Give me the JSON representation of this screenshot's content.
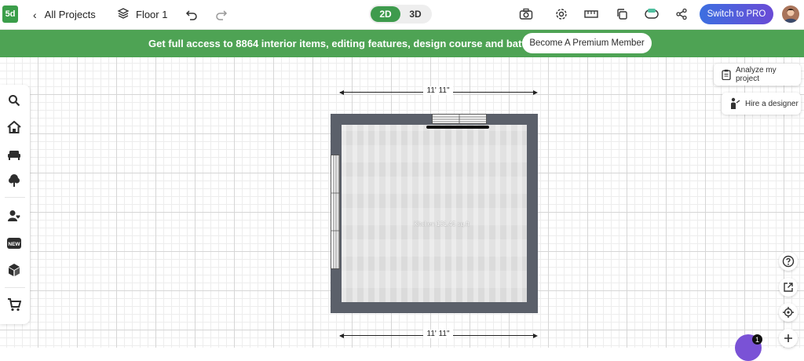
{
  "header": {
    "logo_text": "5d",
    "back_label": "All Projects",
    "floor_label": "Floor 1",
    "view_2d": "2D",
    "view_3d": "3D",
    "switch_pro": "Switch to PRO",
    "icons": [
      "camera-icon",
      "gear-icon",
      "ruler-icon",
      "copy-icon",
      "mixed-reality-icon",
      "share-icon"
    ]
  },
  "banner": {
    "text": "Get full access to 8864 interior items, editing features, design course and battles",
    "button": "Become A Premium Member",
    "color": "#4ea354"
  },
  "right_panel": {
    "analyze": "Analyze my project",
    "hire": "Hire a designer"
  },
  "plan": {
    "dimension_top": "11' 11\"",
    "dimension_bottom": "11' 11\"",
    "room_label": "Kitchen 131.45 sq.ft",
    "wall_color": "#5b606a"
  },
  "notifications": {
    "count": "1"
  }
}
